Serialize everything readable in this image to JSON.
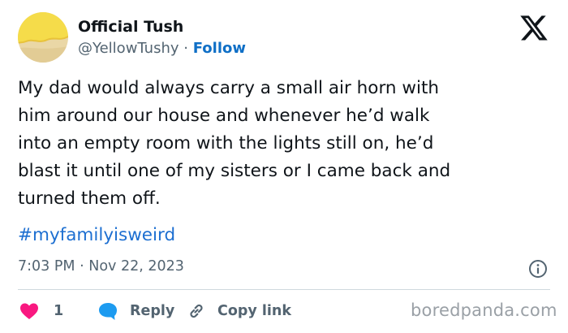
{
  "author": {
    "name": "Official Tush",
    "handle": "@YellowTushy",
    "separator": "·",
    "follow_label": "Follow"
  },
  "tweet": {
    "text": "My dad would always carry a small air horn with\nhim around our house and whenever he’d walk\ninto an empty room with the lights still on, he’d\nblast it until one of my sisters or I came back and\nturned them off.",
    "hashtag": "#myfamilyisweird",
    "time": "7:03 PM",
    "date_separator": "·",
    "date": "Nov 22, 2023"
  },
  "actions": {
    "like_count": "1",
    "reply_label": "Reply",
    "copy_label": "Copy link"
  },
  "watermark": "boredpanda.com",
  "colors": {
    "accent": "#1d6fd1",
    "like": "#f91880",
    "reply_icon": "#1d9bf0",
    "avatar_yellow": "#f5dc4a",
    "avatar_sand": "#ead7a6"
  },
  "icons": [
    "x-logo-icon",
    "heart-icon",
    "reply-bubble-icon",
    "link-icon",
    "info-icon"
  ]
}
